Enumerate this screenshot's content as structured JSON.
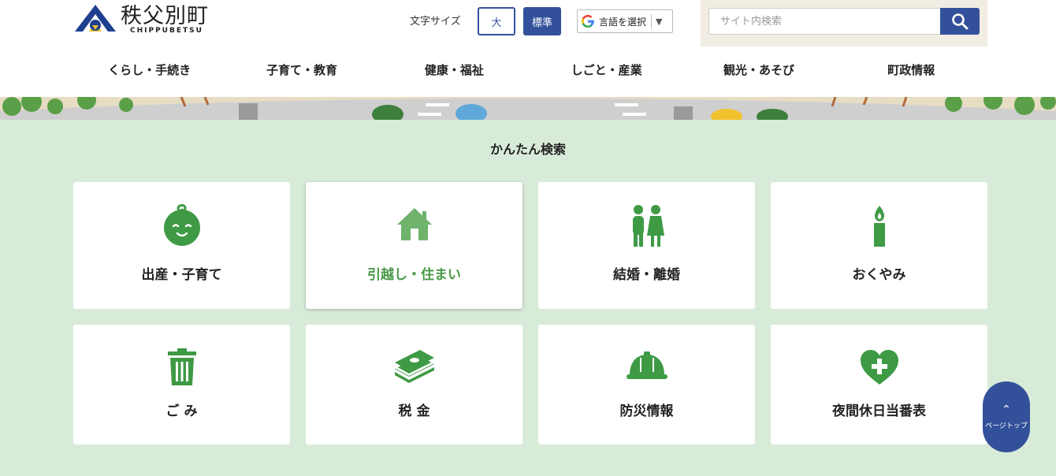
{
  "header": {
    "logo_title": "秩父別町",
    "logo_subtitle": "CHIPPUBETSU",
    "font_size_label": "文字サイズ",
    "font_size_large": "大",
    "font_size_standard": "標準",
    "language_select": "言語を選択",
    "search_placeholder": "サイト内検索"
  },
  "nav": {
    "items": [
      "くらし・手続き",
      "子育て・教育",
      "健康・福祉",
      "しごと・産業",
      "観光・あそび",
      "町政情報"
    ]
  },
  "easy_search": {
    "title": "かんたん検索",
    "cards": [
      {
        "label": "出産・子育て",
        "icon": "baby-face-icon"
      },
      {
        "label": "引越し・住まい",
        "icon": "house-icon"
      },
      {
        "label": "結婚・離婚",
        "icon": "couple-icon"
      },
      {
        "label": "おくやみ",
        "icon": "candle-icon"
      },
      {
        "label": "ご み",
        "icon": "trash-can-icon"
      },
      {
        "label": "税 金",
        "icon": "money-stack-icon"
      },
      {
        "label": "防災情報",
        "icon": "hard-hat-icon"
      },
      {
        "label": "夜間休日当番表",
        "icon": "heart-cross-icon"
      }
    ]
  },
  "page_top": {
    "label": "ページトップ"
  },
  "colors": {
    "brand_blue": "#33519a",
    "icon_green": "#3f9a45",
    "section_bg": "#d8ebd9",
    "search_bg": "#f1ede3"
  }
}
